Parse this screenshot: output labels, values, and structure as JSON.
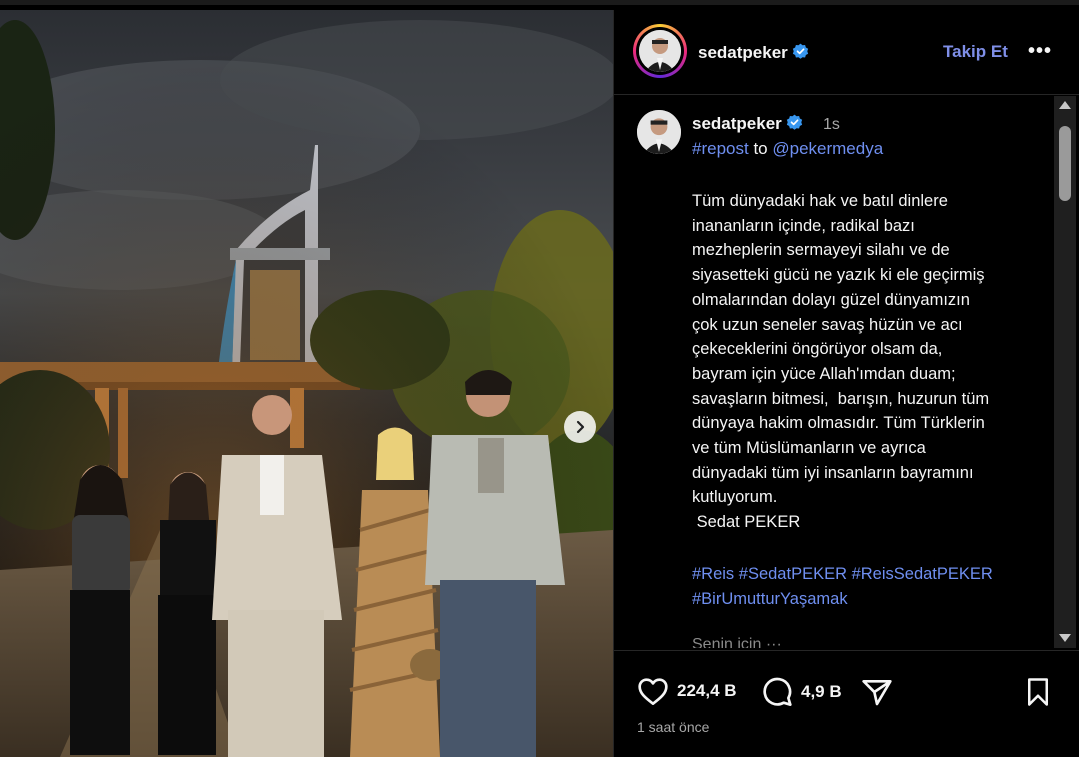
{
  "post": {
    "author": "sedatpeker",
    "follow_label": "Takip Et",
    "more_label": "•••"
  },
  "caption": {
    "author": "sedatpeker",
    "time": "1s",
    "repost_tag": "#repost",
    "repost_to": "to",
    "repost_mention": "@pekermedya",
    "body": "Tüm dünyadaki hak ve batıl dinlere\ninananların içinde, radikal bazı\nmezheplerin sermayeyi silahı ve de\nsiyasetteki gücü ne yazık ki ele geçirmiş\nolmalarından dolayı güzel dünyamızın\nçok uzun seneler savaş hüzün ve acı\nçekeceklerini öngörüyor olsam da,\nbayram için yüce Allah'ımdan duam;\nsavaşların bitmesi,  barışın, huzurun tüm\ndünyaya hakim olmasıdır. Tüm Türklerin\nve tüm Müslümanların ve ayrıca\ndünyadaki tüm iyi insanların bayramını\nkutluyorum.\n Sedat PEKER",
    "hashtags": "#Reis #SedatPEKER #ReisSedatPEKER\n#BirUmutturYaşamak",
    "more_hint": "Senin için ···"
  },
  "actions": {
    "likes": "224,4 B",
    "comments": "4,9 B",
    "time_ago": "1 saat önce"
  },
  "icons": {
    "like": "heart-icon",
    "comment": "comment-bubble-icon",
    "share": "paper-plane-icon",
    "save": "bookmark-icon",
    "next": "chevron-right-icon",
    "verified": "verified-badge-icon"
  },
  "colors": {
    "link": "#6f8ff0",
    "follow": "#7f8fe8",
    "verified": "#3897f0",
    "background": "#000000"
  }
}
